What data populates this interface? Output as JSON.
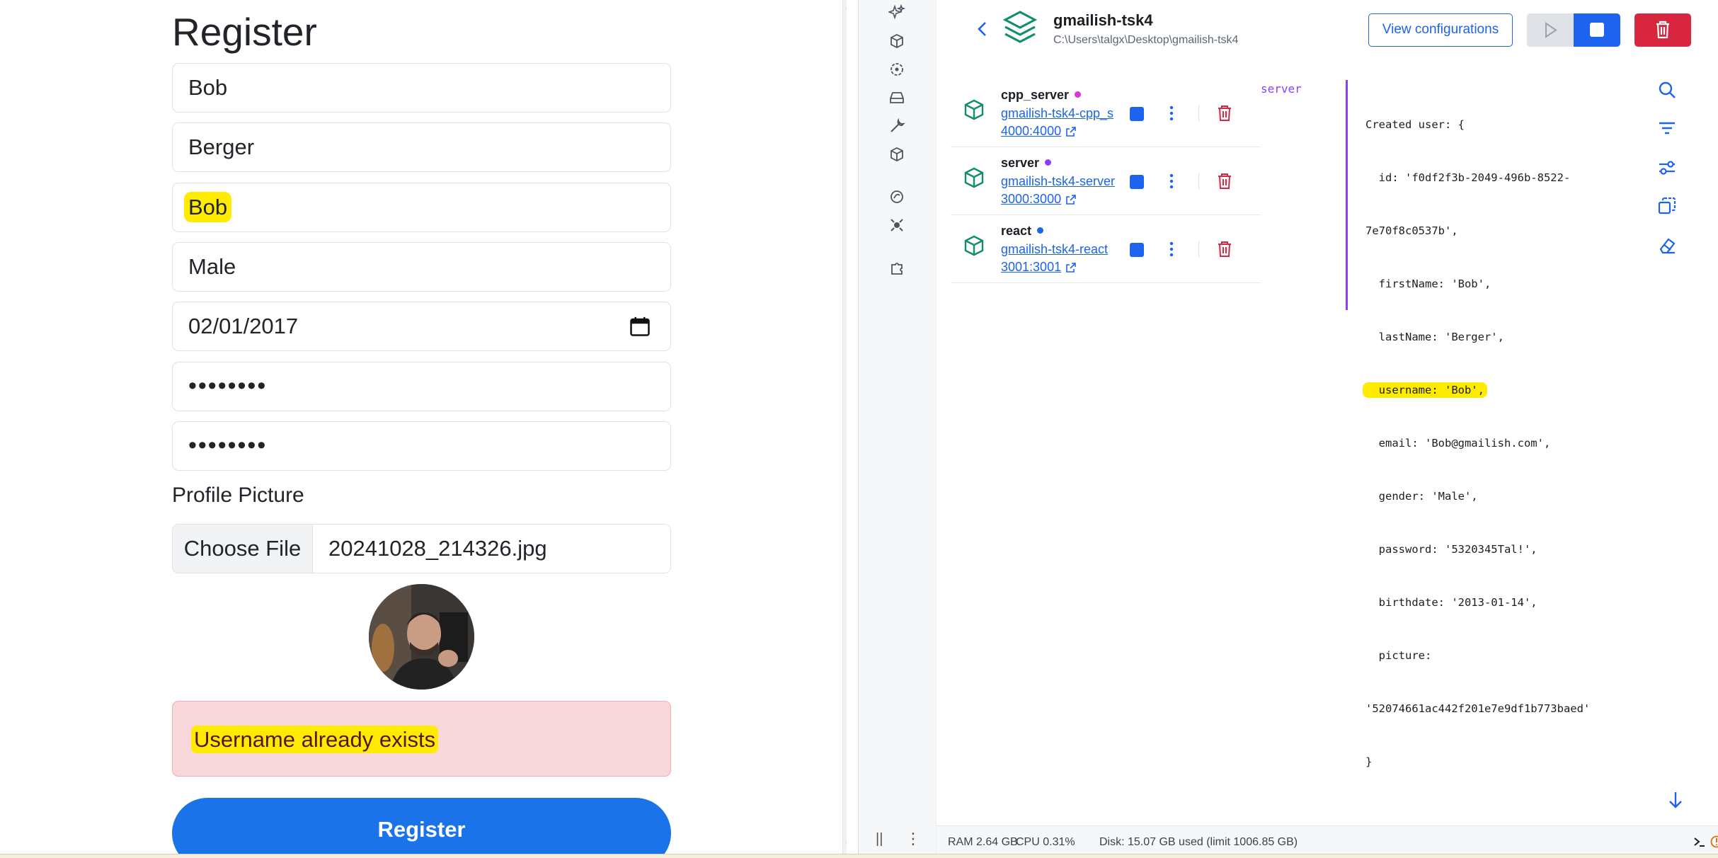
{
  "form": {
    "title": "Register",
    "first_name": "Bob",
    "last_name": "Berger",
    "username": "Bob",
    "gender": "Male",
    "birthdate": "02/01/2017",
    "password_mask": "••••••••",
    "confirm_mask": "••••••••",
    "profile_label": "Profile Picture",
    "choose_file_label": "Choose File",
    "file_name": "20241028_214326.jpg",
    "error": "Username already exists",
    "register_label": "Register"
  },
  "docker": {
    "project_name": "gmailish-tsk4",
    "project_path": "C:\\Users\\talgx\\Desktop\\gmailish-tsk4",
    "view_config_label": "View configurations",
    "containers": [
      {
        "name": "cpp_server",
        "link": "gmailish-tsk4-cpp_s",
        "port": "4000:4000",
        "dot_color": "#d63bd1"
      },
      {
        "name": "server",
        "link": "gmailish-tsk4-server",
        "port": "3000:3000",
        "dot_color": "#8a3ffc"
      },
      {
        "name": "react",
        "link": "gmailish-tsk4-react",
        "port": "3001:3001",
        "dot_color": "#1d63ed"
      }
    ],
    "log_source": "server",
    "log_lines": [
      "Created user: {",
      "  id: 'f0df2f3b-2049-496b-8522-",
      "7e70f8c0537b',",
      "  firstName: 'Bob',",
      "  lastName: 'Berger',",
      "  username: 'Bob',",
      "  email: 'Bob@gmailish.com',",
      "  gender: 'Male',",
      "  password: '5320345Tal!',",
      "  birthdate: '2013-01-14',",
      "  picture:",
      "'52074661ac442f201e7e9df1b773baed'",
      "}"
    ],
    "status": {
      "ram": "RAM 2.64 GB",
      "cpu": "CPU 0.31%",
      "disk": "Disk: 15.07 GB used (limit 1006.85 GB)"
    }
  },
  "colors": {
    "accent": "#1d63ed",
    "danger": "#d7263d",
    "highlight": "#ffeb00",
    "log_accent": "#8a3ffc"
  }
}
